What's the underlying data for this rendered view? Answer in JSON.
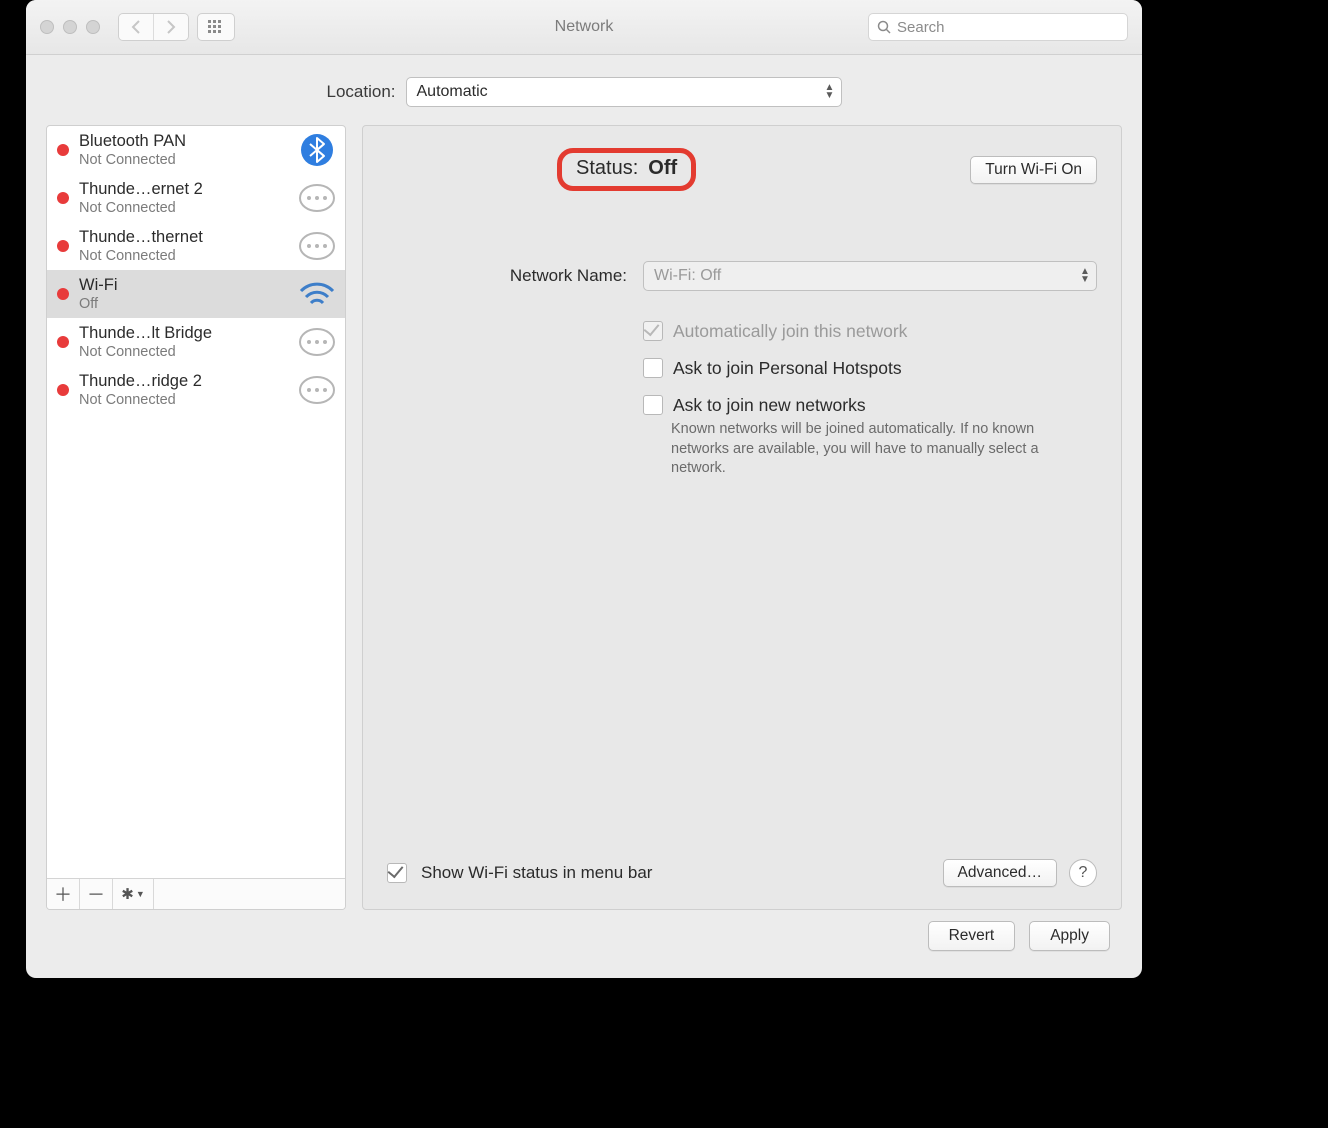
{
  "toolbar": {
    "title": "Network",
    "search_placeholder": "Search"
  },
  "location": {
    "label": "Location:",
    "value": "Automatic"
  },
  "sidebar": {
    "items": [
      {
        "name": "Bluetooth PAN",
        "sub": "Not Connected",
        "icon": "bluetooth"
      },
      {
        "name": "Thunde…ernet 2",
        "sub": "Not Connected",
        "icon": "thunderbolt"
      },
      {
        "name": "Thunde…thernet",
        "sub": "Not Connected",
        "icon": "thunderbolt"
      },
      {
        "name": "Wi-Fi",
        "sub": "Off",
        "icon": "wifi",
        "selected": true
      },
      {
        "name": "Thunde…lt Bridge",
        "sub": "Not Connected",
        "icon": "thunderbolt"
      },
      {
        "name": "Thunde…ridge 2",
        "sub": "Not Connected",
        "icon": "thunderbolt"
      }
    ]
  },
  "detail": {
    "status_label": "Status:",
    "status_value": "Off",
    "toggle_label": "Turn Wi-Fi On",
    "network_name_label": "Network Name:",
    "network_name_value": "Wi-Fi: Off",
    "auto_join_label": "Automatically join this network",
    "ask_hotspot_label": "Ask to join Personal Hotspots",
    "ask_new_label": "Ask to join new networks",
    "ask_new_help": "Known networks will be joined automatically. If no known networks are available, you will have to manually select a network.",
    "show_menu_label": "Show Wi-Fi status in menu bar",
    "advanced_label": "Advanced…"
  },
  "footer": {
    "revert": "Revert",
    "apply": "Apply"
  }
}
